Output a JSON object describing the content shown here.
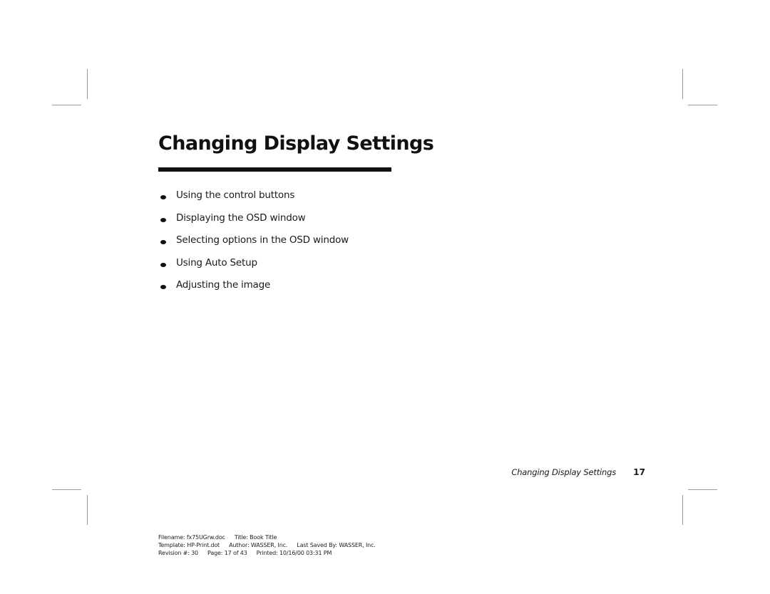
{
  "page": {
    "title": "Changing Display Settings",
    "bullets": [
      "Using the control buttons",
      "Displaying the OSD window",
      "Selecting options in the OSD window",
      "Using Auto Setup",
      "Adjusting the image"
    ],
    "running_footer": {
      "section_title": "Changing Display Settings",
      "page_number": "17"
    },
    "document_info": {
      "filename": "Filename: fx75UGrw.doc",
      "title": "Title: Book Title",
      "template": "Template: HP-Print.dot",
      "author": "Author: WASSER, Inc.",
      "last_saved_by": "Last Saved By: WASSER, Inc.",
      "revision": "Revision #: 30",
      "page": "Page: 17 of 43",
      "printed": "Printed: 10/16/00 03:31 PM"
    }
  }
}
